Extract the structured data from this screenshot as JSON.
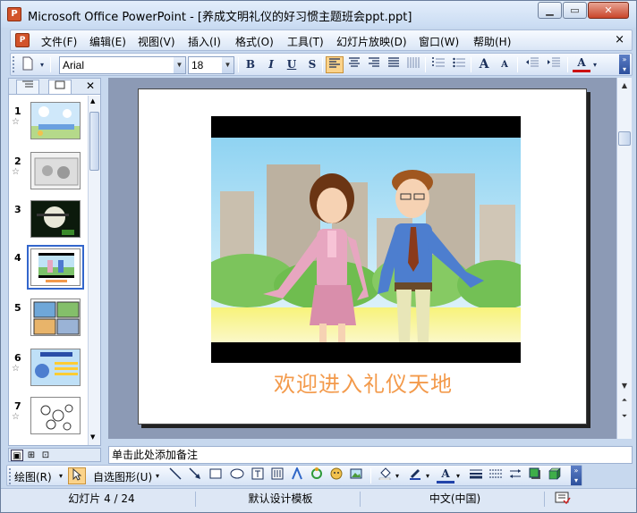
{
  "window": {
    "title": "Microsoft Office PowerPoint - [养成文明礼仪的好习惯主题班会ppt.ppt]",
    "minimize": "▁",
    "restore": "▭",
    "close": "✕"
  },
  "menubar": {
    "items": [
      "文件(F)",
      "编辑(E)",
      "视图(V)",
      "插入(I)",
      "格式(O)",
      "工具(T)",
      "幻灯片放映(D)",
      "窗口(W)",
      "帮助(H)"
    ],
    "doc_close": "×"
  },
  "toolbar": {
    "font_name": "Arial",
    "font_size": "18",
    "bold": "B",
    "italic": "I",
    "underline": "U",
    "shadow": "S",
    "font_grow": "A",
    "font_shrink": "A",
    "font_color": "A"
  },
  "slides_panel": {
    "tab_outline_icon": "outline-icon",
    "tab_slides_icon": "slides-icon",
    "close": "✕",
    "numbers": [
      "1",
      "2",
      "3",
      "4",
      "5",
      "6",
      "7"
    ],
    "star": "☆",
    "selected_index": 4
  },
  "slide": {
    "welcome_text": "欢迎进入礼仪天地"
  },
  "notes": {
    "placeholder": "单击此处添加备注"
  },
  "drawbar": {
    "draw_label": "绘图(R)",
    "autoshapes_label": "自选图形(U)"
  },
  "statusbar": {
    "slide_info": "幻灯片 4 / 24",
    "template": "默认设计模板",
    "language": "中文(中国)"
  },
  "colors": {
    "accent_orange": "#f39a4b",
    "selection_blue": "#3366cc",
    "stage": "#8c9ab5"
  }
}
